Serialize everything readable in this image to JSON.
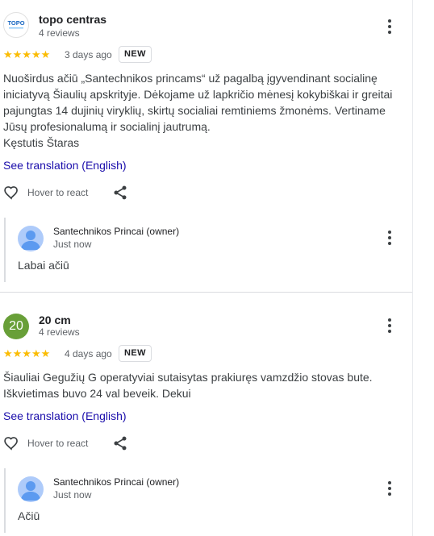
{
  "reviews": [
    {
      "avatar_text": "",
      "logo_text": "TOPO",
      "name": "topo centras",
      "review_count": "4 reviews",
      "stars": "★★★★★",
      "rating": 5,
      "date": "3 days ago",
      "badge": "NEW",
      "text_lines": [
        "Nuoširdus ačiū „Santechnikos princams“ už pagalbą įgyvendinant socialinę",
        "iniciatyvą Šiaulių apskrityje. Dėkojame už lapkričio mėnesį kokybiškai ir greitai",
        "pajungtas 14 dujinių viryklių, skirtų socialiai remtiniems žmonėms. Vertiname",
        "Jūsų profesionalumą ir socialinį jautrumą.",
        "Kęstutis Štaras"
      ],
      "translate": "See translation (English)",
      "react": "Hover to react",
      "owner": {
        "name": "Santechnikos Princai (owner)",
        "time": "Just now",
        "reply": "Labai ačiū"
      }
    },
    {
      "avatar_text": "20",
      "name": "20 cm",
      "review_count": "4 reviews",
      "stars": "★★★★★",
      "rating": 5,
      "date": "4 days ago",
      "badge": "NEW",
      "text_lines": [
        "Šiauliai Gegužių G operatyviai sutaisytas prakiuręs vamzdžio stovas bute.",
        "Iškvietimas buvo 24 val beveik. Dekui"
      ],
      "translate": "See translation (English)",
      "react": "Hover to react",
      "owner": {
        "name": "Santechnikos Princai (owner)",
        "time": "Just now",
        "reply": "Ačiū"
      }
    }
  ],
  "colors": {
    "star": "#fbbc04",
    "link": "#1a0dab",
    "avatar_green": "#689f38",
    "owner_avatar": "#aecbfa"
  },
  "icons": {
    "more": "more-vert-icon",
    "heart": "heart-outline-icon",
    "share": "share-icon",
    "person": "person-icon"
  }
}
